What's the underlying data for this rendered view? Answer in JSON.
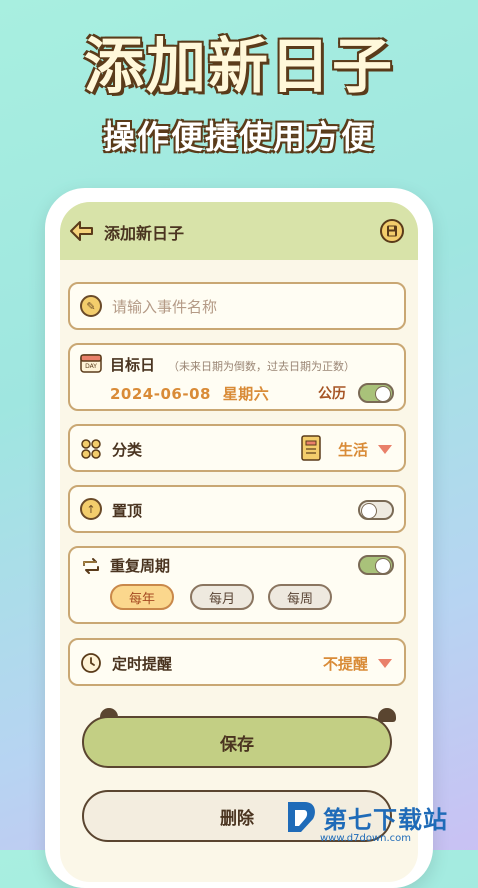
{
  "hero": {
    "title": "添加新日子",
    "subtitle": "操作便捷使用方便"
  },
  "appbar": {
    "title": "添加新日子",
    "back_icon": "arrow-left-icon",
    "save_icon": "floppy-disk-icon"
  },
  "event_name": {
    "placeholder": "请输入事件名称",
    "value": ""
  },
  "target_date": {
    "label": "目标日",
    "hint": "（未来日期为倒数，过去日期为正数）",
    "date": "2024-06-08",
    "weekday": "星期六",
    "calendar_type": "公历",
    "calendar_toggle_on": true
  },
  "category": {
    "label": "分类",
    "value": "生活"
  },
  "pin_top": {
    "label": "置顶",
    "toggle_on": false
  },
  "repeat": {
    "label": "重复周期",
    "toggle_on": true,
    "options": [
      "每年",
      "每月",
      "每周"
    ],
    "selected": "每年"
  },
  "reminder": {
    "label": "定时提醒",
    "value": "不提醒"
  },
  "buttons": {
    "save": "保存",
    "delete": "删除"
  },
  "watermark": {
    "text": "第七下载站",
    "url": "www.d7down.com"
  },
  "colors": {
    "accent": "#d98b37",
    "appbar": "#d8e3a9",
    "save_button": "#c3cf84",
    "border": "#c9a773"
  }
}
